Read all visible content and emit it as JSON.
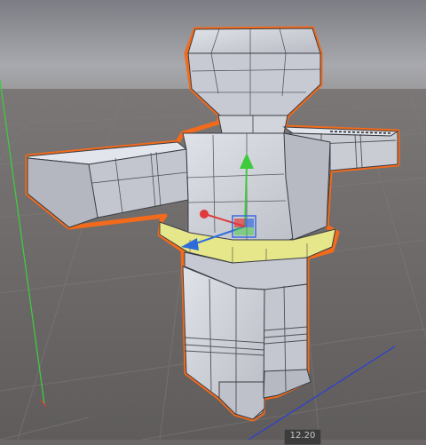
{
  "scene": {
    "sky_color": "#9c9ea5",
    "ground_color": "#6a6766",
    "selection_outline_color": "#f26a1b",
    "mesh_face_color": "#c9ccd3",
    "mesh_wire_color": "#3a3d44",
    "selected_subpart_color": "#e6e68a",
    "grid_axis_colors": {
      "x": "#2d3fd1",
      "y": "#3ecb3e",
      "z": "#e03a3a"
    }
  },
  "gizmo": {
    "axes": [
      {
        "axis": "y",
        "color": "#3ecb3e",
        "icon": "arrow-up-icon"
      },
      {
        "axis": "x",
        "color": "#e03a3a",
        "icon": "arrow-left-icon"
      },
      {
        "axis": "z",
        "color": "#2d6bd8",
        "icon": "arrow-down-left-icon"
      }
    ],
    "center": {
      "color": "#3a6ae0",
      "icon": "rect-handle-icon"
    }
  },
  "status": {
    "readout": "12.20"
  }
}
